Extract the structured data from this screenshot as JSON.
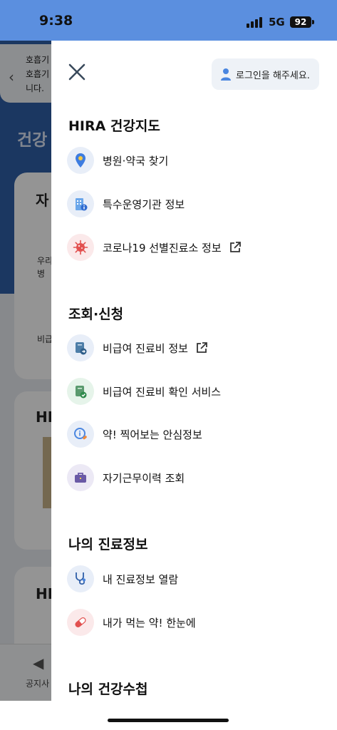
{
  "status_bar": {
    "time": "9:38",
    "network": "5G",
    "battery": "92"
  },
  "background_page": {
    "notice_text": "호흡기\n호흡기\n니다.",
    "title": "건강",
    "card1_title": "자",
    "card1_text": "우리\n병",
    "card1_text2": "비급",
    "card2_title": "HI",
    "card3_title": "HI",
    "tab_label": "공지사"
  },
  "drawer": {
    "login_label": "로그인을 해주세요.",
    "sections": [
      {
        "title": "HIRA 건강지도",
        "items": [
          {
            "label": "병원·약국 찾기",
            "icon": "map-pin-icon",
            "external": false
          },
          {
            "label": "특수운영기관 정보",
            "icon": "building-info-icon",
            "external": false
          },
          {
            "label": "코로나19 선별진료소 정보",
            "icon": "virus-icon",
            "external": true
          }
        ]
      },
      {
        "title": "조회·신청",
        "items": [
          {
            "label": "비급여 진료비 정보",
            "icon": "bill-arrow-icon",
            "external": true
          },
          {
            "label": "비급여 진료비 확인 서비스",
            "icon": "bill-check-icon",
            "external": false
          },
          {
            "label": "약! 찍어보는 안심정보",
            "icon": "pill-info-icon",
            "external": false
          },
          {
            "label": "자기근무이력 조회",
            "icon": "briefcase-icon",
            "external": false
          }
        ]
      },
      {
        "title": "나의 진료정보",
        "items": [
          {
            "label": "내 진료정보 열람",
            "icon": "stethoscope-icon",
            "external": false
          },
          {
            "label": "내가 먹는 약! 한눈에",
            "icon": "capsule-icon",
            "external": false
          }
        ]
      },
      {
        "title": "나의 건강수첩",
        "items": []
      }
    ]
  },
  "colors": {
    "status_bar": "#5b8fdf",
    "overlay": "rgba(0,0,0,0.42)",
    "icon_blue_bg": "#e8eef8",
    "icon_red_bg": "#fbe9ea",
    "icon_green_bg": "#e6f4ea"
  }
}
